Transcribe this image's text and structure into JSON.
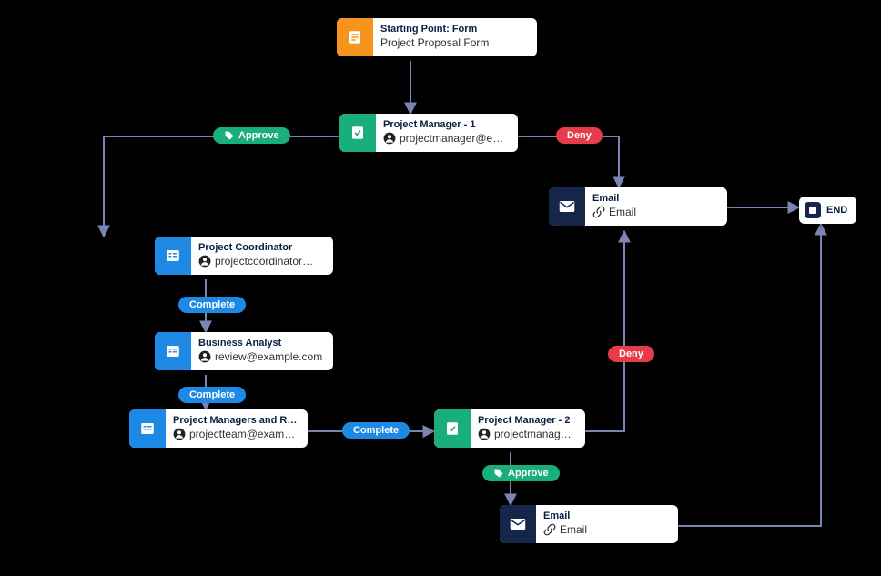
{
  "nodes": {
    "start": {
      "title": "Starting Point: Form",
      "sub": "Project Proposal Form"
    },
    "pm1": {
      "title": "Project Manager - 1",
      "sub": "projectmanager@exa..."
    },
    "coord": {
      "title": "Project Coordinator",
      "sub": "projectcoordinator@e..."
    },
    "ba": {
      "title": "Business Analyst",
      "sub": "review@example.com"
    },
    "pmrev": {
      "title": "Project Managers and Revie...",
      "sub": "projectteam@exampl..."
    },
    "pm2": {
      "title": "Project Manager - 2",
      "sub": "projectmanager@exa..."
    },
    "email1": {
      "title": "Email",
      "sub": "Email"
    },
    "email2": {
      "title": "Email",
      "sub": "Email"
    },
    "end": {
      "label": "END"
    }
  },
  "badges": {
    "approve1": "Approve",
    "deny1": "Deny",
    "complete1": "Complete",
    "complete2": "Complete",
    "complete3": "Complete",
    "approve2": "Approve",
    "deny2": "Deny"
  },
  "colors": {
    "orange": "#f7941d",
    "green": "#1aae7b",
    "blue": "#1e88e5",
    "navy": "#15264a",
    "red": "#e53b4a",
    "connector": "#7a85b3"
  }
}
